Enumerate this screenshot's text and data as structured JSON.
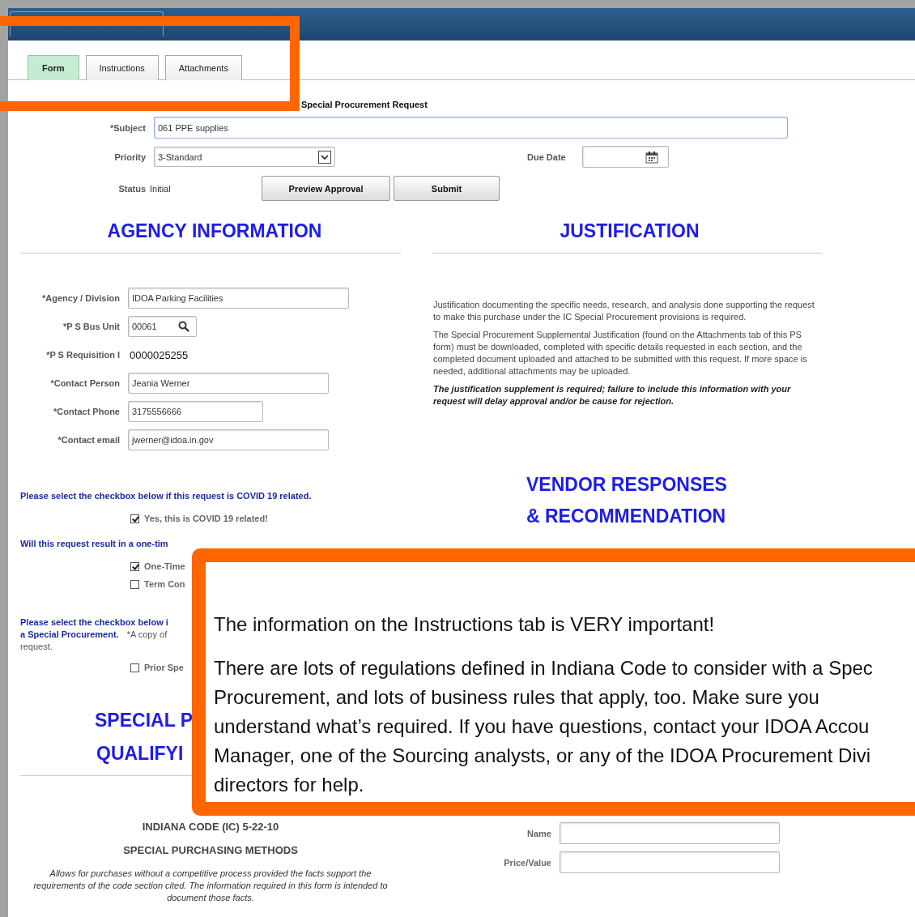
{
  "tabs": [
    {
      "label": "Form",
      "selected": true
    },
    {
      "label": "Instructions",
      "selected": false
    },
    {
      "label": "Attachments",
      "selected": false
    }
  ],
  "form": {
    "title": "Special Procurement Request",
    "subject": {
      "label": "*Subject",
      "value": "061 PPE supplies"
    },
    "priority": {
      "label": "Priority",
      "value": "3-Standard"
    },
    "due_date": {
      "label": "Due Date"
    },
    "status": {
      "label": "Status",
      "value": "Initial"
    },
    "buttons": [
      "Preview Approval",
      "Submit"
    ]
  },
  "agency": {
    "heading": "AGENCY INFORMATION",
    "fields": [
      {
        "label": "*Agency / Division",
        "value": "IDOA Parking Facilities",
        "kind": "wide"
      },
      {
        "label": "*P S Bus Unit",
        "value": "00061",
        "kind": "lookup"
      },
      {
        "label": "*P S Requisition I",
        "value": "0000025255",
        "kind": "display"
      },
      {
        "label": "*Contact Person",
        "value": "Jeania Werner",
        "kind": "medium"
      },
      {
        "label": "*Contact Phone",
        "value": "3175556666",
        "kind": "short"
      },
      {
        "label": "*Contact email",
        "value": "jwerner@idoa.in.gov",
        "kind": "medium"
      }
    ]
  },
  "covid": {
    "prompt": "Please select the checkbox below if this request is COVID 19 related.",
    "option": {
      "label": "Yes, this is COVID 19 related!",
      "checked": true
    }
  },
  "purchase_type": {
    "prompt": "Will this request result in a one-tim",
    "options": [
      {
        "label": "One-Time",
        "checked": true
      },
      {
        "label": "Term Con",
        "checked": false
      }
    ]
  },
  "prior": {
    "prompt_lines": [
      "Please select the checkbox below i",
      "a Special Procurement."
    ],
    "note_lines": [
      "*A copy of",
      "request."
    ],
    "option": {
      "label": "Prior Spe",
      "checked": false
    }
  },
  "qualifying": {
    "heading_lines": [
      "SPECIAL P",
      "QUALIFYI"
    ],
    "code": "INDIANA CODE (IC) 5-22-10",
    "subtitle": "SPECIAL PURCHASING METHODS",
    "description": "Allows for purchases without a competitive process provided the facts support the requirements of the code section cited.  The information required in this form is intended to document those facts."
  },
  "justification": {
    "heading": "JUSTIFICATION",
    "paragraphs": [
      "Justification documenting the specific needs, research, and analysis done supporting the request to make this purchase under the IC Special Procurement provisions is required.",
      "The Special Procurement Supplemental Justification (found on the Attachments tab of this PS form) must be downloaded, completed with specific details requested in each section, and the completed document uploaded and attached to be submitted with this request.  If more space is needed, additional attachments may be uploaded."
    ],
    "warning": "The justification supplement is required; failure to include this information with your request will delay approval and/or be cause for rejection."
  },
  "vendor": {
    "heading_lines": [
      "VENDOR RESPONSES",
      "& RECOMMENDATION"
    ],
    "fields": [
      {
        "label": "Name"
      },
      {
        "label": "Price/Value"
      }
    ]
  },
  "callout": {
    "headline": "The information on the Instructions tab is VERY important!",
    "lines": [
      "There are lots of regulations defined in Indiana Code to consider with a Spec",
      "Procurement, and lots of business rules that apply, too.  Make sure you",
      "understand what’s required.  If you have questions, contact your IDOA Accou",
      "Manager, one of the Sourcing analysts, or any of the IDOA Procurement Divi",
      "directors for help."
    ]
  }
}
